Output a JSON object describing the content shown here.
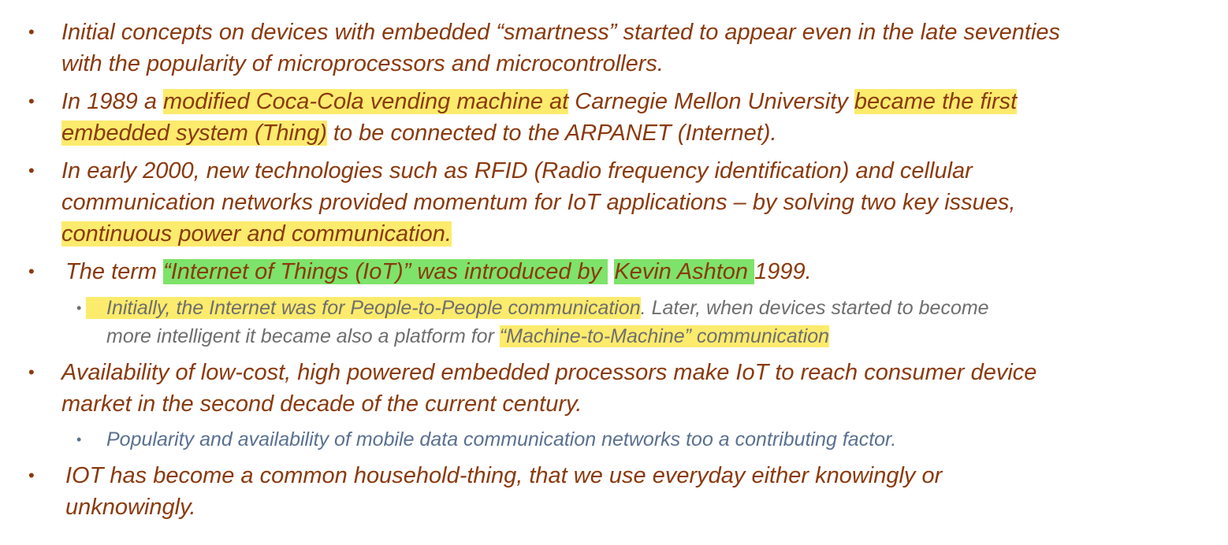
{
  "bullets": {
    "b1": {
      "line1": "Initial concepts on devices with embedded “smartness” started to appear even in the late seventies",
      "line2": "with the popularity of microprocessors and microcontrollers."
    },
    "b2": {
      "t1": "In 1989 a ",
      "t2": "modified Coca-Cola vending machine at",
      "t3": " Carnegie Mellon University ",
      "t4": "became the first",
      "t5": "embedded system (Thing)",
      "t6": " to be connected to the ARPANET (Internet)."
    },
    "b3": {
      "line1": "In early 2000, new technologies such as RFID (Radio frequency identification) and cellular",
      "line2": "communication networks provided momentum for IoT applications – by solving two key issues,",
      "line3": "continuous power and communication."
    },
    "b4": {
      "t1": "The term ",
      "t2": "“Internet of Things (IoT)” was introduced by ",
      "t3": "Kevin Ashton ",
      "t4": "1999."
    },
    "b4sub": {
      "t1": "Initially, the Internet was for People-to-People communication",
      "t2": ".  Later, when devices started to become",
      "t3": "more intelligent it became also a platform for ",
      "t4": "“Machine-to-Machine” communication"
    },
    "b5": {
      "line1": "Availability of low-cost, high powered embedded processors make IoT to reach consumer device",
      "line2": "market in the second decade of the current century."
    },
    "b5sub": {
      "text": "Popularity and availability of mobile data communication networks too a contributing factor."
    },
    "b6": {
      "line1": "IOT has become a common household-thing, that we use everyday either knowingly or",
      "line2": "unknowingly."
    }
  },
  "bullet_glyph": "•",
  "colors": {
    "main_text": "#8a3a0e",
    "sub_text_grey": "#6e6e6e",
    "sub_text_blue": "#5a7090",
    "highlight_yellow": "#fdeb6d",
    "highlight_green": "#7ee36a"
  }
}
